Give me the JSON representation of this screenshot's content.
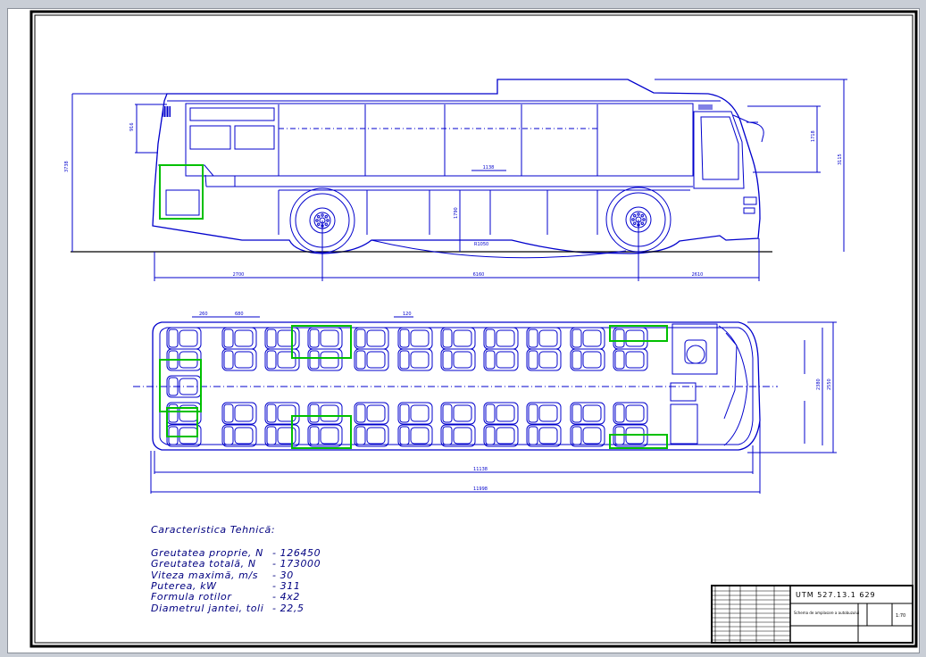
{
  "specs": {
    "title": "Caracteristica Tehnică:",
    "rows": [
      {
        "label": "Greutatea proprie, N",
        "value": "- 126450"
      },
      {
        "label": "Greutatea totală, N",
        "value": "- 173000"
      },
      {
        "label": "Viteza maximă, m/s",
        "value": "- 30"
      },
      {
        "label": "Puterea, kW",
        "value": "- 311"
      },
      {
        "label": "Formula rotilor",
        "value": "- 4x2"
      },
      {
        "label": "Diametrul jantei, toli",
        "value": "- 22,5"
      }
    ]
  },
  "dimensions": {
    "overall_height": "3738",
    "window_height": "916",
    "upper_right": "1718",
    "right_total": "3115",
    "front_overhang": "2700",
    "wheelbase": "6160",
    "rear_overhang": "2610",
    "plan_inner_length": "11138",
    "plan_overall_length": "11998",
    "seat_pitch_a": "260",
    "seat_pitch_b": "680",
    "aisle_dim": "120",
    "plan_width_inner": "2380",
    "plan_width_outer": "2550",
    "mid_panel": "1138",
    "floor_height": "1790",
    "ground_clear": "R1050"
  },
  "title_block": {
    "code": "UTM 527.13.1 629",
    "desc": "Schema de amplasare a autobuzului",
    "scale": "1:70"
  },
  "colors": {
    "line": "#0000cc",
    "highlight": "#00c000",
    "frame": "#000000",
    "text": "#000080"
  }
}
